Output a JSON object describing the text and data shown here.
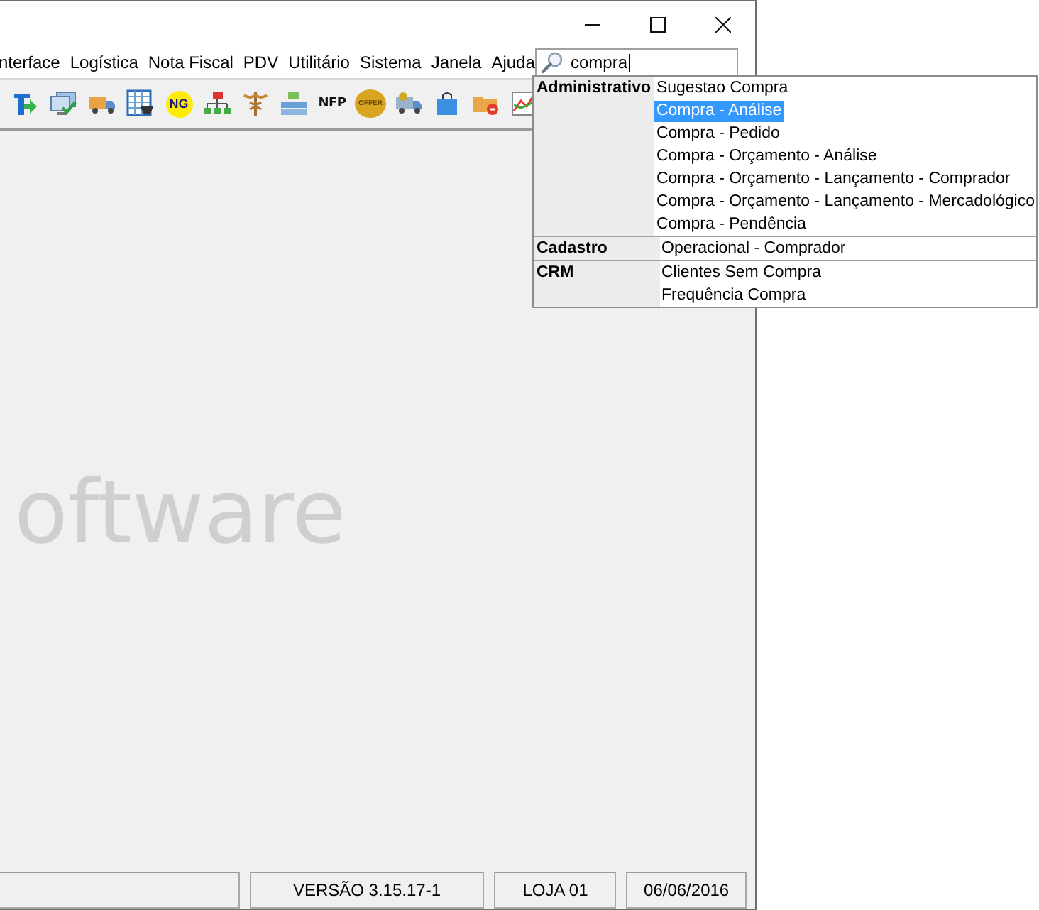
{
  "window": {
    "controls": [
      {
        "kind": "minimize"
      },
      {
        "kind": "maximize"
      },
      {
        "kind": "close"
      }
    ]
  },
  "menu": [
    "nterface",
    "Logística",
    "Nota Fiscal",
    "PDV",
    "Utilitário",
    "Sistema",
    "Janela",
    "Ajuda"
  ],
  "search": {
    "value": "compra"
  },
  "toolbar": [
    {
      "kind": "t-arrow"
    },
    {
      "kind": "monitor"
    },
    {
      "kind": "truck"
    },
    {
      "kind": "sheet-cart"
    },
    {
      "kind": "badge",
      "label": "NG"
    },
    {
      "kind": "network"
    },
    {
      "kind": "caduceus"
    },
    {
      "kind": "org"
    },
    {
      "kind": "text",
      "label": "NFP"
    },
    {
      "kind": "seal",
      "label": "OFFER"
    },
    {
      "kind": "truck-money"
    },
    {
      "kind": "bag"
    },
    {
      "kind": "folder-remove"
    },
    {
      "kind": "chart"
    }
  ],
  "results": [
    {
      "group": "Administrativo",
      "items": [
        {
          "label": "Sugestao Compra",
          "selected": false
        },
        {
          "label": "Compra - Análise",
          "selected": true
        },
        {
          "label": "Compra - Pedido",
          "selected": false
        },
        {
          "label": "Compra - Orçamento - Análise",
          "selected": false
        },
        {
          "label": "Compra - Orçamento - Lançamento - Comprador",
          "selected": false
        },
        {
          "label": "Compra - Orçamento - Lançamento - Mercadológico",
          "selected": false
        },
        {
          "label": "Compra - Pendência",
          "selected": false
        }
      ]
    },
    {
      "group": "Cadastro",
      "items": [
        {
          "label": "Operacional - Comprador",
          "selected": false
        }
      ]
    },
    {
      "group": "CRM",
      "items": [
        {
          "label": "Clientes Sem Compra",
          "selected": false
        },
        {
          "label": "Frequência Compra",
          "selected": false
        }
      ]
    }
  ],
  "watermark": "oftware",
  "status_bar": [
    "VERSÃO 3.15.17-1",
    "LOJA 01",
    "06/06/2016"
  ]
}
